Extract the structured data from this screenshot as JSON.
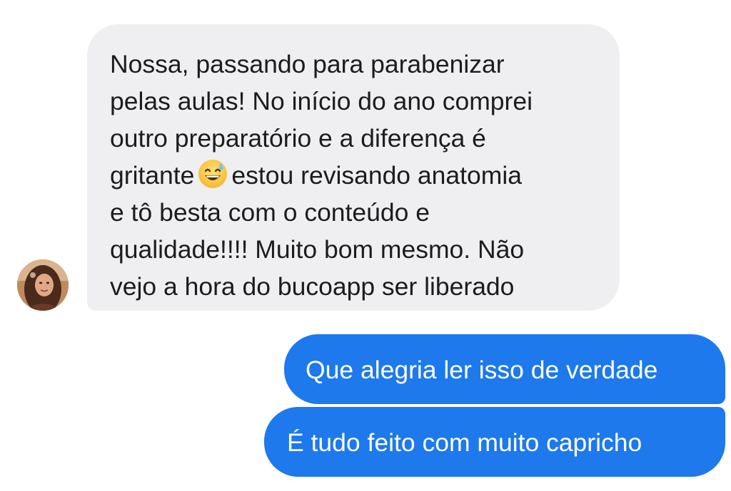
{
  "conversation": {
    "incoming": {
      "lines": [
        "Nossa, passando para parabenizar",
        "pelas aulas! No início do ano comprei",
        "outro preparatório e a diferença é",
        "gritante",
        "estou revisando anatomia",
        "e tô besta com o conteúdo e",
        "qualidade!!!! Muito bom mesmo. Não",
        "vejo a hora do bucoapp ser liberado"
      ],
      "emoji": "grinning-face-with-sweat-emoji"
    },
    "outgoing": [
      {
        "text": "Que alegria ler isso de verdade"
      },
      {
        "text": "É tudo feito com muito capricho"
      }
    ]
  },
  "colors": {
    "incoming_bubble": "#efeff1",
    "outgoing_bubble": "#1d79ec",
    "incoming_text": "#1c1c1e",
    "outgoing_text": "#ffffff"
  }
}
